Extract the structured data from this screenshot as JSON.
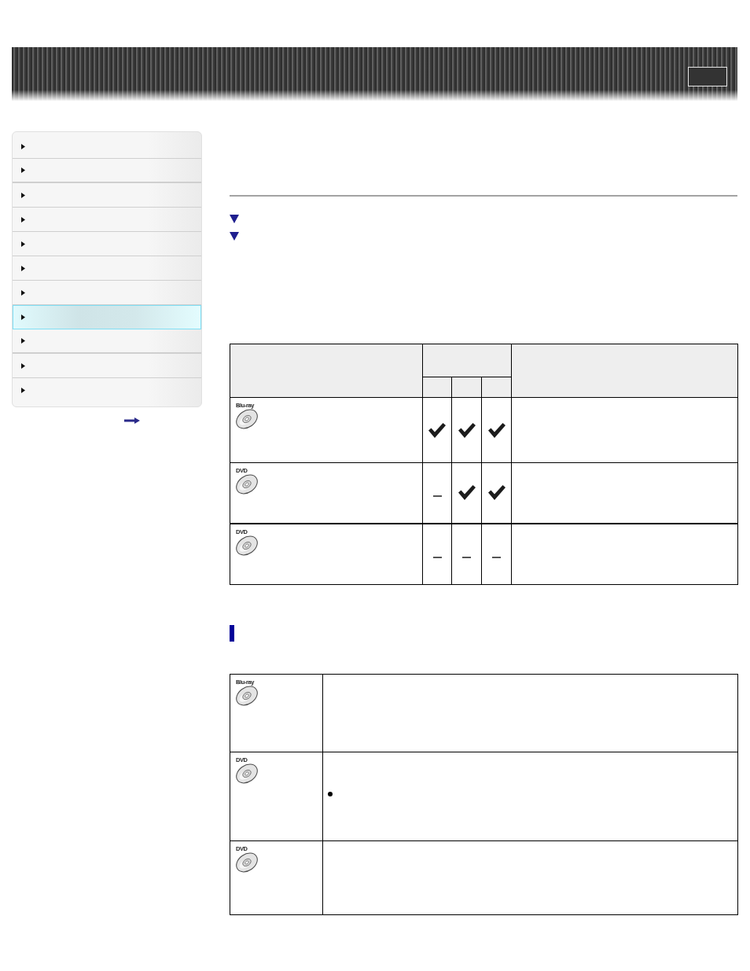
{
  "sidebar": {
    "items": [
      {
        "selected": false
      },
      {
        "selected": false
      },
      {
        "selected": false
      },
      {
        "selected": false
      },
      {
        "selected": false
      },
      {
        "selected": false
      },
      {
        "selected": false
      },
      {
        "selected": true
      },
      {
        "selected": false
      },
      {
        "selected": false
      },
      {
        "selected": false
      }
    ]
  },
  "compat_table": {
    "rows": [
      {
        "disc_label": "Blu-ray",
        "cells": [
          {
            "supported": true
          },
          {
            "supported": true
          },
          {
            "supported": true
          }
        ]
      },
      {
        "disc_label": "DVD",
        "cells": [
          {
            "supported": false
          },
          {
            "supported": true
          },
          {
            "supported": true
          }
        ]
      },
      {
        "disc_label": "DVD",
        "cells": [
          {
            "supported": false
          },
          {
            "supported": false
          },
          {
            "supported": false
          }
        ]
      }
    ]
  },
  "details_table": {
    "rows": [
      {
        "disc_label": "Blu-ray",
        "bullet": false
      },
      {
        "disc_label": "DVD",
        "bullet": true
      },
      {
        "disc_label": "DVD",
        "bullet": false
      }
    ]
  }
}
